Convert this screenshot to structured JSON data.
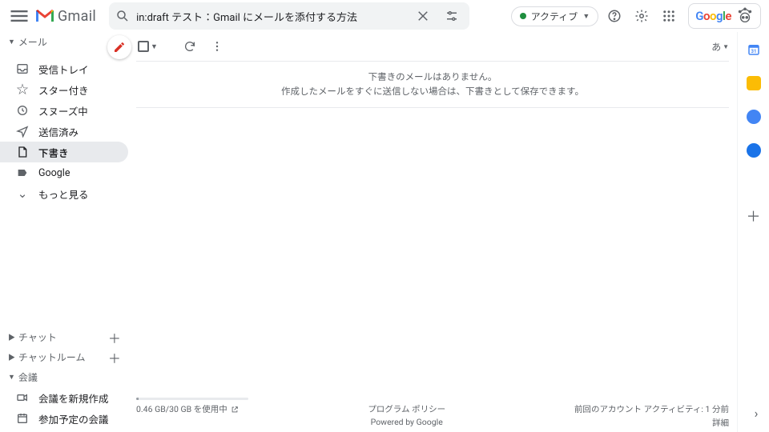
{
  "header": {
    "product_name": "Gmail",
    "search_value": "in:draft テスト：Gmail にメールを添付する方法",
    "active_label": "アクティブ",
    "brand_word": "Google"
  },
  "sidebar": {
    "section_mail": "メール",
    "items": [
      {
        "label": "受信トレイ"
      },
      {
        "label": "スター付き"
      },
      {
        "label": "スヌーズ中"
      },
      {
        "label": "送信済み"
      },
      {
        "label": "下書き"
      },
      {
        "label": "Google"
      },
      {
        "label": "もっと見る"
      }
    ],
    "section_chat": "チャット",
    "section_rooms": "チャットルーム",
    "section_meet": "会議",
    "meet_new": "会議を新規作成",
    "meet_join": "参加予定の会議"
  },
  "toolbar": {
    "lang_indicator": "あ"
  },
  "empty": {
    "line1": "下書きのメールはありません。",
    "line2": "作成したメールをすぐに送信しない場合は、下書きとして保存できます。"
  },
  "footer": {
    "storage_text": "0.46 GB/30 GB を使用中",
    "program_policy": "プログラム ポリシー",
    "powered_by": "Powered by Google",
    "activity": "前回のアカウント アクティビティ: 1 分前",
    "details": "詳細"
  }
}
